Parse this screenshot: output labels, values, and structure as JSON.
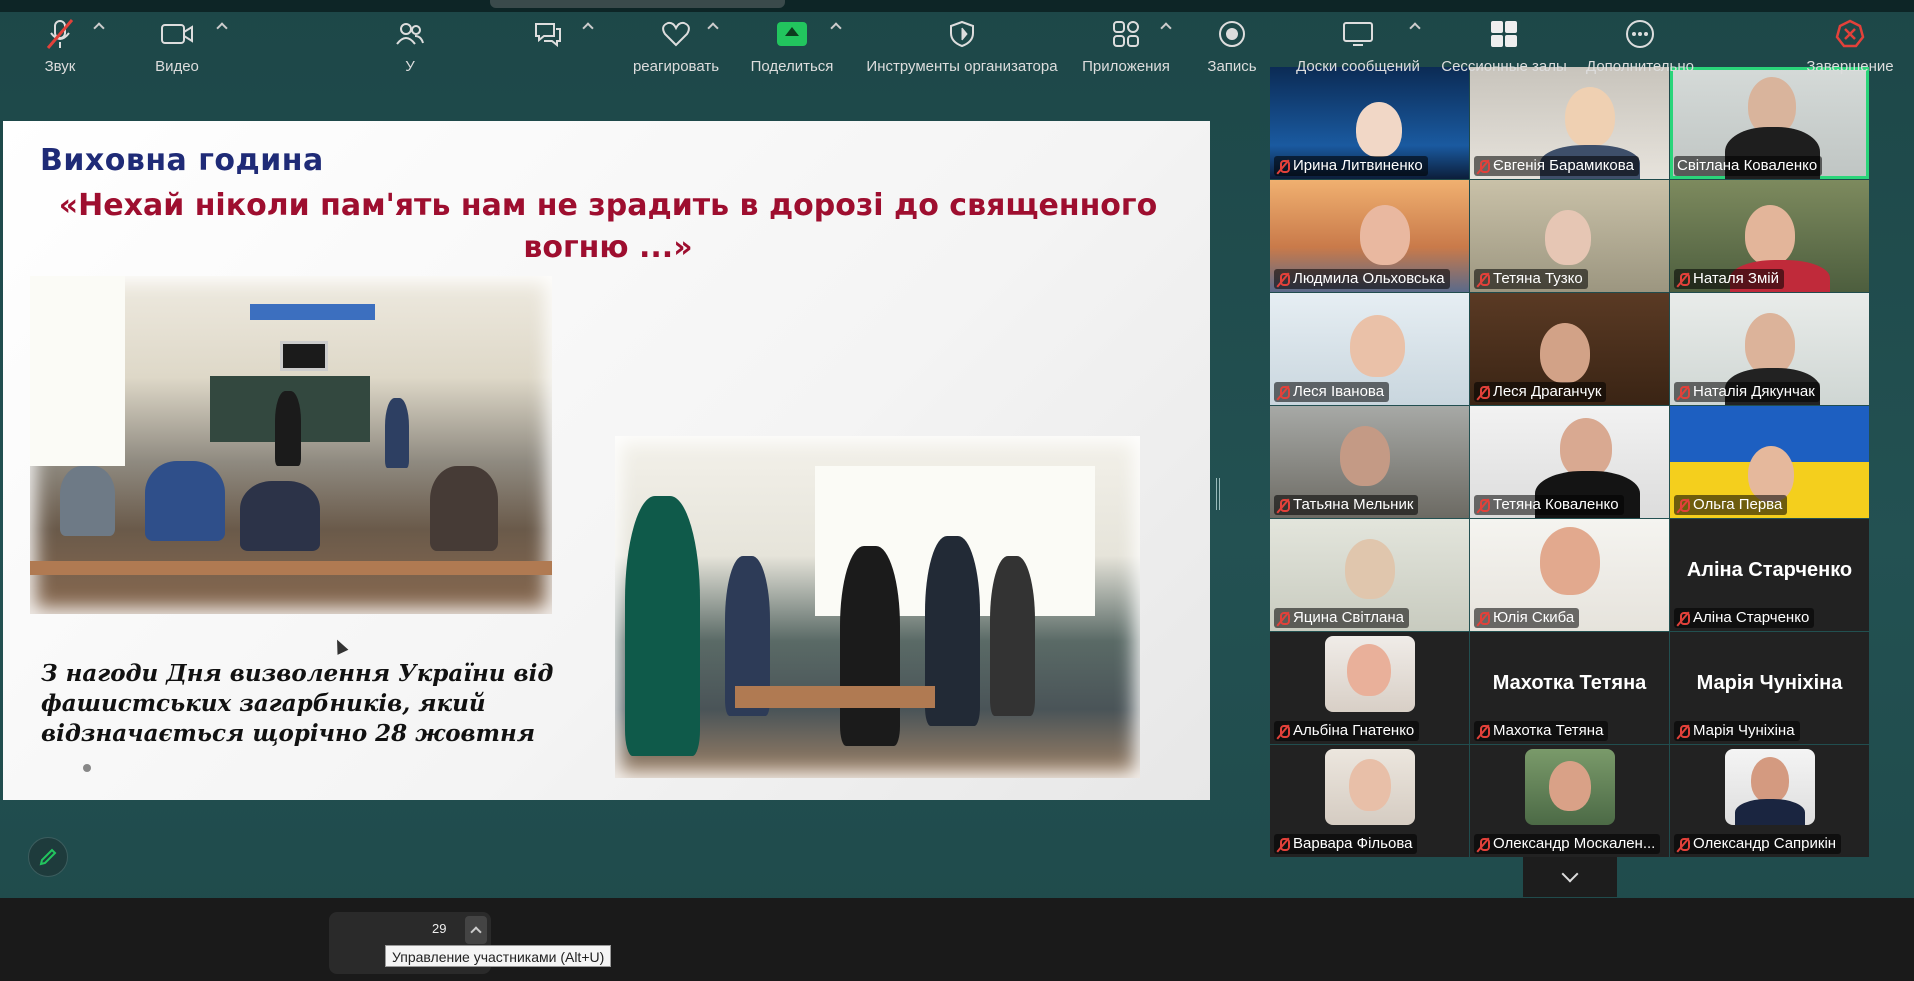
{
  "slide": {
    "title": "Виховна година",
    "quote_line1": "«Нехай ніколи пам'ять нам не зрадить в дорозі до священного",
    "quote_line2": "вогню ...»",
    "caption_line1": "З нагоди Дня визволення України від",
    "caption_line2": "фашистських загарбників, який",
    "caption_line3": "відзначається щорічно 28 жовтня"
  },
  "participants": [
    {
      "name": "Ирина Литвиненко"
    },
    {
      "name": "Євгенія Барамикова"
    },
    {
      "name": "Світлана Коваленко"
    },
    {
      "name": "Людмила Ольховська"
    },
    {
      "name": "Тетяна Тузко"
    },
    {
      "name": "Наталя Змій"
    },
    {
      "name": "Леся Іванова"
    },
    {
      "name": "Леся Драганчук"
    },
    {
      "name": "Наталія Дякунчак"
    },
    {
      "name": "Татьяна Мельник"
    },
    {
      "name": "Тетяна  Коваленко"
    },
    {
      "name": "Ольга Перва"
    },
    {
      "name": "Яцина Світлана"
    },
    {
      "name": "Юлія Скиба"
    },
    {
      "name": "Аліна Старченко",
      "big": "Аліна Старченко"
    },
    {
      "name": "Альбіна Гнатенко"
    },
    {
      "name": "Махотка Тетяна",
      "big": "Махотка Тетяна"
    },
    {
      "name": "Марія Чуніхіна",
      "big": "Марія Чуніхіна"
    },
    {
      "name": "Варвара Фільова"
    },
    {
      "name": "Олександр Москален..."
    },
    {
      "name": "Олександр Саприкін"
    }
  ],
  "toolbar": {
    "audio": "Звук",
    "video": "Видео",
    "participants_label": "У",
    "participants_count": "29",
    "tooltip": "Управление участниками (Alt+U)",
    "react": "реагировать",
    "share": "Поделиться",
    "host_tools": "Инструменты организатора",
    "apps": "Приложения",
    "record": "Запись",
    "whiteboards": "Доски сообщений",
    "breakout": "Сессионные залы",
    "more": "Дополнительно",
    "end": "Завершение"
  },
  "colors": {
    "background": "#235152",
    "toolbar": "#1a1a1a",
    "active_speaker": "#2ad57a",
    "end_red": "#e2413a",
    "share_green": "#22c55e",
    "slide_title": "#1f2b77",
    "slide_quote": "#9e0e2f"
  }
}
